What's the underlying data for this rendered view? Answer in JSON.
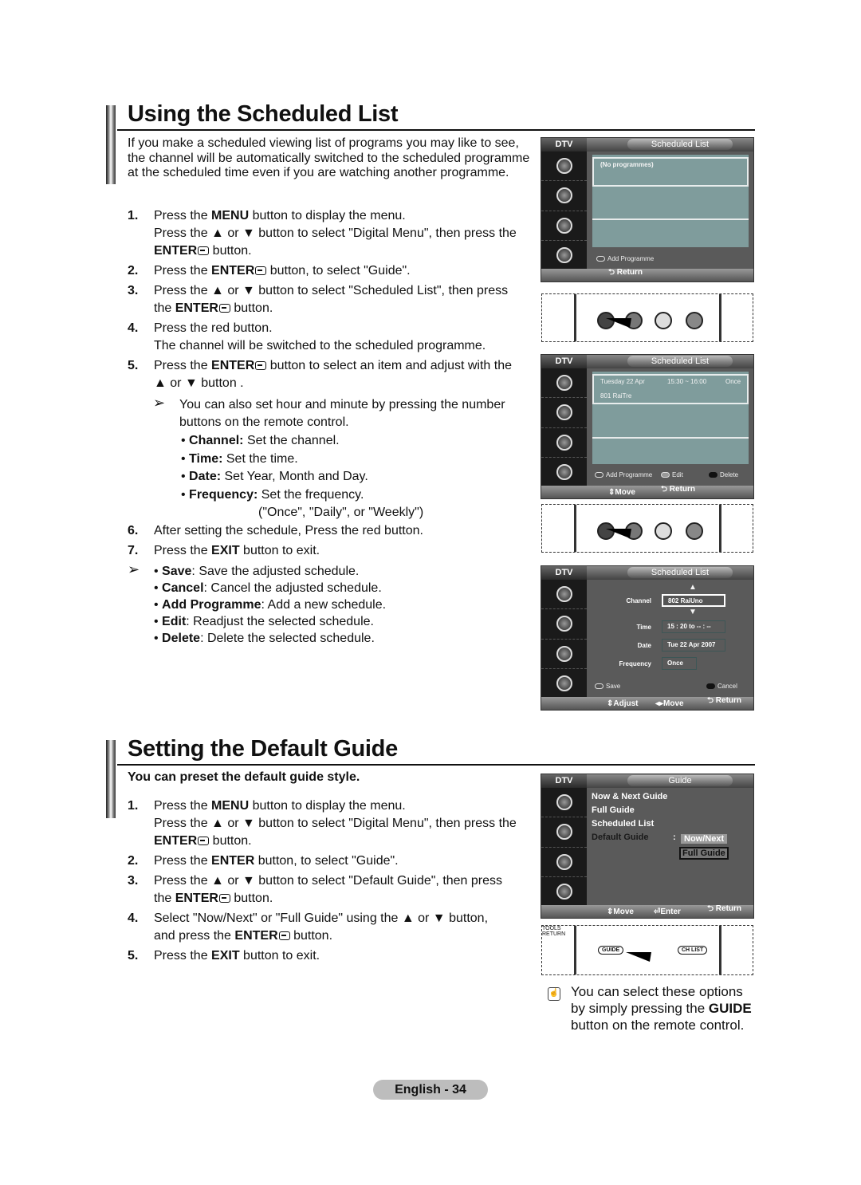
{
  "section1": {
    "title": "Using the Scheduled List",
    "intro": "If you make a scheduled viewing list of programs you may like to see, the channel will be automatically switched to the scheduled programme at the scheduled time even if you are watching another programme.",
    "steps": [
      {
        "num": "1.",
        "pre": "Press the ",
        "bold": "MENU",
        "post": " button to display the menu."
      },
      {
        "num": "",
        "pre": "Press the ▲ or ▼ button to select \"Digital Menu\", then press the",
        "bold": "",
        "post": ""
      },
      {
        "num": "",
        "pre": "",
        "bold": "ENTER",
        "post": " button.",
        "enter": true
      },
      {
        "num": "2.",
        "pre": "Press the ",
        "bold": "ENTER",
        "post": " button, to select \"Guide\".",
        "enter": true
      },
      {
        "num": "3.",
        "pre": "Press the ▲ or ▼ button to select \"Scheduled List\", then press",
        "bold": "",
        "post": ""
      },
      {
        "num": "",
        "pre": "the ",
        "bold": "ENTER",
        "post": " button.",
        "enter": true
      },
      {
        "num": "4.",
        "pre": "Press the red button.",
        "bold": "",
        "post": ""
      },
      {
        "num": "",
        "pre": "The channel will be switched to the scheduled programme.",
        "bold": "",
        "post": ""
      },
      {
        "num": "5.",
        "pre": "Press the ",
        "bold": "ENTER",
        "post": " button to select an item and adjust with the",
        "enter": true
      },
      {
        "num": "",
        "pre": "▲ or ▼ button .",
        "bold": "",
        "post": ""
      }
    ],
    "note1": {
      "arrow": "➢",
      "line1": "You can also set hour and minute by pressing the number",
      "line2": "buttons on the remote control."
    },
    "items": [
      {
        "label": "Channel:",
        "desc": " Set the channel."
      },
      {
        "label": "Time:",
        "desc": " Set the time."
      },
      {
        "label": "Date:",
        "desc": " Set Year, Month and Day."
      },
      {
        "label": "Frequency:",
        "desc": " Set the frequency."
      }
    ],
    "frequency_options": "(\"Once\", \"Daily\", or \"Weekly\")",
    "steps2": [
      {
        "num": "6.",
        "pre": "After setting the schedule, Press the red button.",
        "bold": "",
        "post": ""
      },
      {
        "num": "7.",
        "pre": "Press the ",
        "bold": "EXIT",
        "post": " button to exit."
      }
    ],
    "note2_arrow": "➢",
    "actions": [
      {
        "label": "Save",
        "desc": ": Save the adjusted schedule."
      },
      {
        "label": "Cancel",
        "desc": ": Cancel the adjusted schedule."
      },
      {
        "label": "Add Programme",
        "desc": ": Add a new schedule."
      },
      {
        "label": "Edit",
        "desc": ": Readjust the selected schedule."
      },
      {
        "label": "Delete",
        "desc": ": Delete the selected schedule."
      }
    ]
  },
  "screen1": {
    "dtv": "DTV",
    "title": "Scheduled List",
    "empty": "(No programmes)",
    "legend": [
      "Add Programme"
    ],
    "footer": [
      "Return"
    ]
  },
  "screen2": {
    "dtv": "DTV",
    "title": "Scheduled List",
    "entry": {
      "day": "Tuesday  22  Apr",
      "time": "15:30 ~ 16:00",
      "freq": "Once",
      "channel": "801  RaiTre"
    },
    "legend": [
      "Add Programme",
      "Edit",
      "Delete"
    ],
    "footer": [
      "Move",
      "Return"
    ]
  },
  "screen3": {
    "dtv": "DTV",
    "title": "Scheduled List",
    "fields": [
      {
        "label": "Channel",
        "value": "802 RaiUno"
      },
      {
        "label": "Time",
        "value": "15 : 20 to -- : --"
      },
      {
        "label": "Date",
        "value": "Tue 22 Apr 2007"
      },
      {
        "label": "Frequency",
        "value": "Once"
      }
    ],
    "legend": [
      "Save",
      "Cancel"
    ],
    "footer": [
      "Adjust",
      "Move",
      "Return"
    ]
  },
  "section2": {
    "title": "Setting the Default Guide",
    "subtitle": "You can preset the default guide style.",
    "steps": [
      {
        "num": "1.",
        "pre": "Press the ",
        "bold": "MENU",
        "post": " button to display the menu."
      },
      {
        "num": "",
        "pre": "Press the ▲ or ▼ button to select \"Digital Menu\", then press the",
        "bold": "",
        "post": ""
      },
      {
        "num": "",
        "pre": "",
        "bold": "ENTER",
        "post": " button.",
        "enter": true
      },
      {
        "num": "2.",
        "pre": "Press the ",
        "bold": "ENTER",
        "post": " button, to select \"Guide\"."
      },
      {
        "num": "3.",
        "pre": "Press the ▲ or ▼ button to select \"Default Guide\", then press",
        "bold": "",
        "post": ""
      },
      {
        "num": "",
        "pre": "the ",
        "bold": "ENTER",
        "post": " button.",
        "enter": true
      },
      {
        "num": "4.",
        "pre": "Select \"Now/Next\" or \"Full Guide\" using the ▲ or ▼ button,",
        "bold": "",
        "post": ""
      },
      {
        "num": "",
        "pre": "and press the ",
        "bold": "ENTER",
        "post": " button.",
        "enter": true
      },
      {
        "num": "5.",
        "pre": "Press the ",
        "bold": "EXIT",
        "post": " button to exit."
      }
    ]
  },
  "screen4": {
    "dtv": "DTV",
    "title": "Guide",
    "menu": [
      "Now & Next Guide",
      "Full Guide",
      "Scheduled List",
      "Default Guide"
    ],
    "colon": ":",
    "options": [
      "Now/Next",
      "Full Guide"
    ],
    "footer": [
      "Move",
      "Enter",
      "Return"
    ]
  },
  "remote2": {
    "labels": [
      "GUIDE",
      "CH LIST",
      "TOOLS",
      "RETURN"
    ]
  },
  "tip": {
    "line1": "You can select these options",
    "line2_pre": "by simply pressing the ",
    "line2_bold": "GUIDE",
    "line3": "button on the remote control."
  },
  "footer": {
    "page": "English - 34"
  }
}
